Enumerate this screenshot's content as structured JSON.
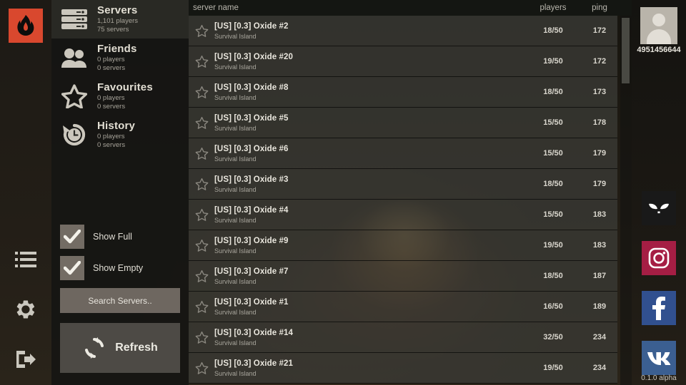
{
  "app": {
    "logo_icon": "flame-icon",
    "logo_color": "#d9482e",
    "version": "0.1.0 alpha"
  },
  "rail": {
    "items": [
      {
        "icon": "list-icon",
        "name": "server-list"
      },
      {
        "icon": "gear-icon",
        "name": "settings"
      },
      {
        "icon": "exit-icon",
        "name": "quit"
      }
    ]
  },
  "sidebar": {
    "items": [
      {
        "icon": "servers-icon",
        "title": "Servers",
        "players": "1,101 players",
        "servers": "75 servers",
        "selected": true
      },
      {
        "icon": "friends-icon",
        "title": "Friends",
        "players": "0 players",
        "servers": "0 servers",
        "selected": false
      },
      {
        "icon": "star-icon",
        "title": "Favourites",
        "players": "0 players",
        "servers": "0 servers",
        "selected": false
      },
      {
        "icon": "history-icon",
        "title": "History",
        "players": "0 players",
        "servers": "0 servers",
        "selected": false
      }
    ],
    "checkboxes": [
      {
        "label": "Show Full",
        "checked": true
      },
      {
        "label": "Show Empty",
        "checked": true
      }
    ],
    "search_placeholder": "Search Servers..",
    "refresh_label": "Refresh",
    "refresh_icon": "refresh-icon"
  },
  "table": {
    "columns": {
      "name": "server name",
      "players": "players",
      "ping": "ping"
    },
    "rows": [
      {
        "name": "[US] [0.3] Oxide #2",
        "map": "Survival Island",
        "players": "18/50",
        "ping": "172"
      },
      {
        "name": "[US] [0.3] Oxide #20",
        "map": "Survival Island",
        "players": "19/50",
        "ping": "172"
      },
      {
        "name": "[US] [0.3] Oxide #8",
        "map": "Survival Island",
        "players": "18/50",
        "ping": "173"
      },
      {
        "name": "[US] [0.3] Oxide #5",
        "map": "Survival Island",
        "players": "15/50",
        "ping": "178"
      },
      {
        "name": "[US] [0.3] Oxide #6",
        "map": "Survival Island",
        "players": "15/50",
        "ping": "179"
      },
      {
        "name": "[US] [0.3] Oxide #3",
        "map": "Survival Island",
        "players": "18/50",
        "ping": "179"
      },
      {
        "name": "[US] [0.3] Oxide #4",
        "map": "Survival Island",
        "players": "15/50",
        "ping": "183"
      },
      {
        "name": "[US] [0.3] Oxide #9",
        "map": "Survival Island",
        "players": "19/50",
        "ping": "183"
      },
      {
        "name": "[US] [0.3] Oxide #7",
        "map": "Survival Island",
        "players": "18/50",
        "ping": "187"
      },
      {
        "name": "[US] [0.3] Oxide #1",
        "map": "Survival Island",
        "players": "16/50",
        "ping": "189"
      },
      {
        "name": "[US] [0.3] Oxide #14",
        "map": "Survival Island",
        "players": "32/50",
        "ping": "234"
      },
      {
        "name": "[US] [0.3] Oxide #21",
        "map": "Survival Island",
        "players": "19/50",
        "ping": "234"
      }
    ]
  },
  "user": {
    "id": "4951456644",
    "avatar_icon": "avatar-placeholder-icon"
  },
  "social": [
    {
      "name": "studio-logo-icon",
      "color": "#191919"
    },
    {
      "name": "instagram-icon",
      "color": "#a51e44"
    },
    {
      "name": "facebook-icon",
      "color": "#31508f"
    },
    {
      "name": "vk-icon",
      "color": "#3b5f91"
    }
  ]
}
